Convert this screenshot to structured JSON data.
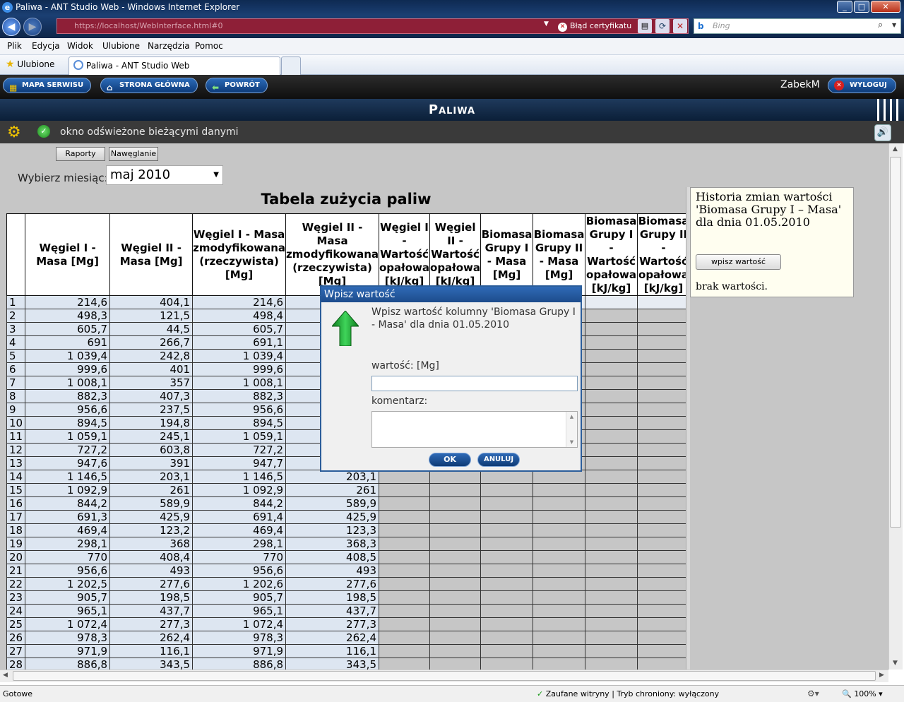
{
  "browser": {
    "window_title": "Paliwa - ANT Studio Web - Windows Internet Explorer",
    "url": "https://localhost/WebInterface.html#0",
    "cert_error": "Błąd certyfikatu",
    "search_placeholder": "Bing",
    "menu": [
      "Plik",
      "Edycja",
      "Widok",
      "Ulubione",
      "Narzędzia",
      "Pomoc"
    ],
    "favorites_label": "Ulubione",
    "tab_title": "Paliwa - ANT Studio Web",
    "status_left": "Gotowe",
    "status_zone": "Zaufane witryny | Tryb chroniony: wyłączony",
    "zoom": "100%"
  },
  "app": {
    "nav": {
      "site_map": "MAPA SERWISU",
      "home": "STRONA GŁÓWNA",
      "back": "POWRÓT"
    },
    "username": "ZabekM",
    "logout": "WYLOGUJ",
    "page_title": "Paliwa",
    "status_message": "okno odświeżone bieżącymi danymi",
    "buttons": {
      "reports": "Raporty",
      "watering": "Nawęglanie"
    },
    "month_label": "Wybierz miesiąc:",
    "month_value": "maj 2010",
    "table_title": "Tabela zużycia paliw"
  },
  "table": {
    "headers": [
      "",
      "Węgiel I - Masa [Mg]",
      "Węgiel II - Masa [Mg]",
      "Węgiel I - Masa zmodyfikowana (rzeczywista) [Mg]",
      "Węgiel II - Masa zmodyfikowana (rzeczywista) [Mg]",
      "Węgiel I - Wartość opałowa [kJ/kg]",
      "Węgiel II - Wartość opałowa [kJ/kg]",
      "Biomasa Grupy I - Masa [Mg]",
      "Biomasa Grupy II - Masa [Mg]",
      "Biomasa Grupy I - Wartość opałowa [kJ/kg]",
      "Biomasa Grupy II - Wartość opałowa [kJ/kg]"
    ],
    "rows": [
      [
        "1",
        "214,6",
        "404,1",
        "214,6",
        ""
      ],
      [
        "2",
        "498,3",
        "121,5",
        "498,4",
        ""
      ],
      [
        "3",
        "605,7",
        "44,5",
        "605,7",
        ""
      ],
      [
        "4",
        "691",
        "266,7",
        "691,1",
        ""
      ],
      [
        "5",
        "1 039,4",
        "242,8",
        "1 039,4",
        ""
      ],
      [
        "6",
        "999,6",
        "401",
        "999,6",
        ""
      ],
      [
        "7",
        "1 008,1",
        "357",
        "1 008,1",
        ""
      ],
      [
        "8",
        "882,3",
        "407,3",
        "882,3",
        ""
      ],
      [
        "9",
        "956,6",
        "237,5",
        "956,6",
        ""
      ],
      [
        "10",
        "894,5",
        "194,8",
        "894,5",
        ""
      ],
      [
        "11",
        "1 059,1",
        "245,1",
        "1 059,1",
        ""
      ],
      [
        "12",
        "727,2",
        "603,8",
        "727,2",
        ""
      ],
      [
        "13",
        "947,6",
        "391",
        "947,7",
        ""
      ],
      [
        "14",
        "1 146,5",
        "203,1",
        "1 146,5",
        "203,1"
      ],
      [
        "15",
        "1 092,9",
        "261",
        "1 092,9",
        "261"
      ],
      [
        "16",
        "844,2",
        "589,9",
        "844,2",
        "589,9"
      ],
      [
        "17",
        "691,3",
        "425,9",
        "691,4",
        "425,9"
      ],
      [
        "18",
        "469,4",
        "123,2",
        "469,4",
        "123,3"
      ],
      [
        "19",
        "298,1",
        "368",
        "298,1",
        "368,3"
      ],
      [
        "20",
        "770",
        "408,4",
        "770",
        "408,5"
      ],
      [
        "21",
        "956,6",
        "493",
        "956,6",
        "493"
      ],
      [
        "22",
        "1 202,5",
        "277,6",
        "1 202,6",
        "277,6"
      ],
      [
        "23",
        "905,7",
        "198,5",
        "905,7",
        "198,5"
      ],
      [
        "24",
        "965,1",
        "437,7",
        "965,1",
        "437,7"
      ],
      [
        "25",
        "1 072,4",
        "277,3",
        "1 072,4",
        "277,3"
      ],
      [
        "26",
        "978,3",
        "262,4",
        "978,3",
        "262,4"
      ],
      [
        "27",
        "971,9",
        "116,1",
        "971,9",
        "116,1"
      ],
      [
        "28",
        "886,8",
        "343,5",
        "886,8",
        "343,5"
      ]
    ]
  },
  "history": {
    "title": "Historia zmian wartości 'Biomasa Grupy I – Masa' dla dnia 01.05.2010",
    "button": "wpisz wartość",
    "empty": "brak wartości."
  },
  "dialog": {
    "title": "Wpisz wartość",
    "message": "Wpisz wartość kolumny 'Biomasa Grupy I - Masa' dla dnia 01.05.2010",
    "value_label": "wartość: [Mg]",
    "value": "",
    "comment_label": "komentarz:",
    "comment": "",
    "ok": "OK",
    "cancel": "ANULUJ"
  },
  "colors": {
    "accent": "#1d4c8c",
    "header_dark": "#0b1f38",
    "cell_blue": "#dde6f1",
    "grey_bg": "#c6c6c6"
  }
}
